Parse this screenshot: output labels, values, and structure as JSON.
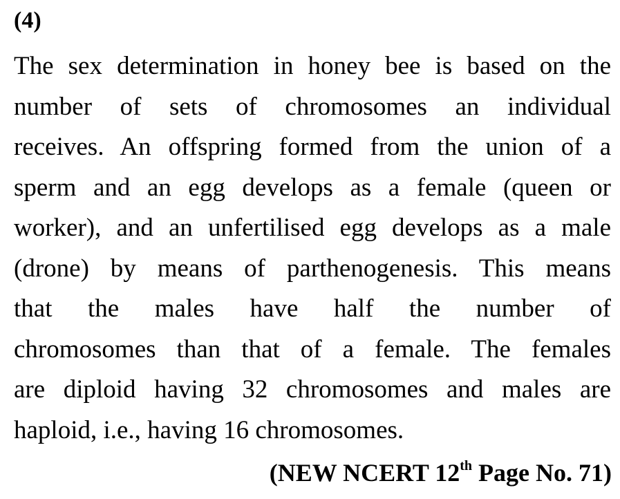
{
  "question": {
    "number": "(4)"
  },
  "answer": {
    "lines": [
      "The sex determination in honey bee is based on the",
      "number of sets of chromosomes an individual",
      "receives. An offspring formed from the union of a",
      "sperm and an egg develops as a female (queen or",
      "worker), and an unfertilised egg develops as a male",
      "(drone) by means of parthenogenesis. This means",
      "that the males have half the number of",
      "chromosomes than that of a female. The females",
      "are diploid having 32 chromosomes and males are",
      "haploid, i.e., having 16 chromosomes."
    ]
  },
  "reference": {
    "prefix": "(NEW NCERT 12",
    "superscript": "th",
    "suffix": " Page No. 71)"
  }
}
